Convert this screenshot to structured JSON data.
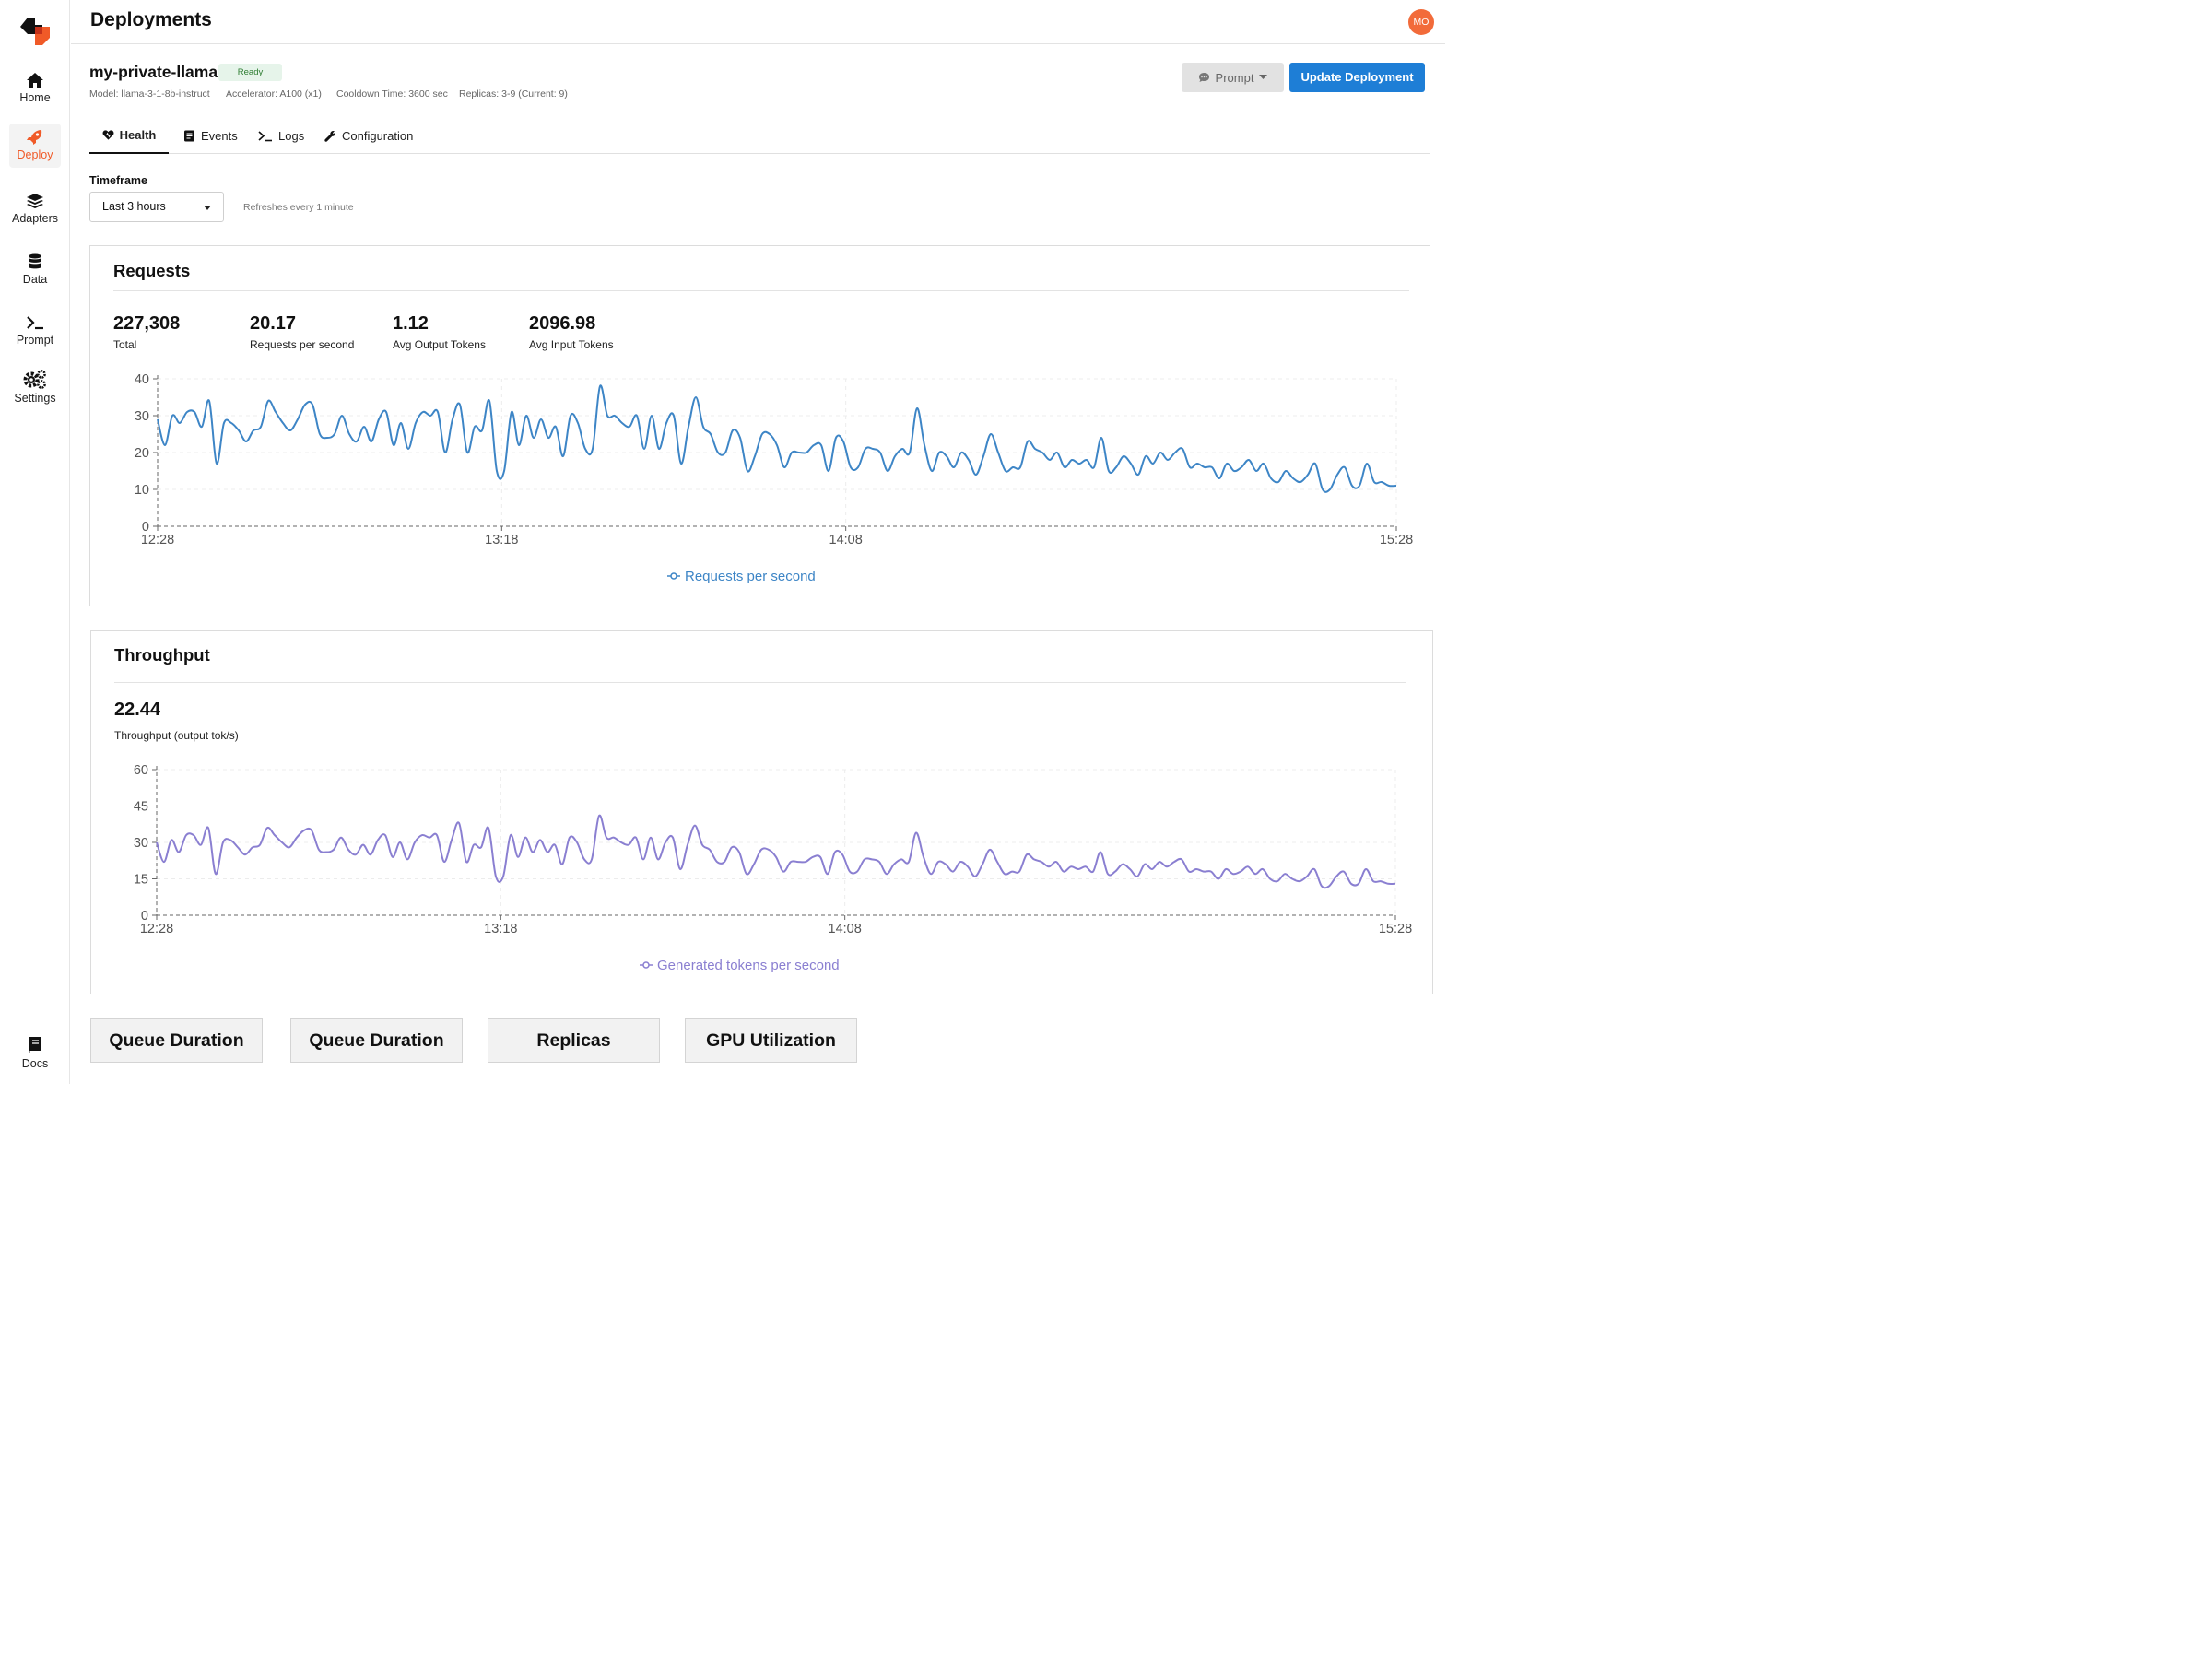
{
  "sidebar": {
    "items": [
      {
        "label": "Home"
      },
      {
        "label": "Deploy"
      },
      {
        "label": "Adapters"
      },
      {
        "label": "Data"
      },
      {
        "label": "Prompt"
      },
      {
        "label": "Settings"
      }
    ],
    "docs_label": "Docs"
  },
  "header": {
    "title": "Deployments",
    "avatar_initials": "MO"
  },
  "deployment": {
    "name": "my-private-llama",
    "status": "Ready",
    "model": "Model: llama-3-1-8b-instruct",
    "accelerator": "Accelerator:  A100 (x1)",
    "cooldown": "Cooldown Time: 3600 sec",
    "replicas": "Replicas: 3-9 (Current: 9)",
    "prompt_button": "Prompt",
    "update_button": "Update Deployment"
  },
  "tabs": [
    {
      "label": "Health",
      "icon": "heart-icon",
      "active": true
    },
    {
      "label": "Events",
      "icon": "events-icon"
    },
    {
      "label": "Logs",
      "icon": "terminal-icon"
    },
    {
      "label": "Configuration",
      "icon": "wrench-icon"
    }
  ],
  "timeframe": {
    "label": "Timeframe",
    "selected": "Last 3 hours",
    "refresh_note": "Refreshes every 1 minute"
  },
  "requests": {
    "title": "Requests",
    "stats": [
      {
        "value": "227,308",
        "label": "Total"
      },
      {
        "value": "20.17",
        "label": "Requests per second"
      },
      {
        "value": "1.12",
        "label": "Avg Output Tokens"
      },
      {
        "value": "2096.98",
        "label": "Avg Input Tokens"
      }
    ]
  },
  "throughput": {
    "title": "Throughput",
    "stat_value": "22.44",
    "stat_label": "Throughput (output tok/s)"
  },
  "bottom_sections": [
    "Queue Duration",
    "Queue Duration",
    "Replicas",
    "GPU Utilization"
  ],
  "colors": {
    "accent_orange": "#f05a28",
    "primary_blue": "#1e7ed6",
    "requests_line": "#3d85c6",
    "throughput_line": "#8a7fd1"
  },
  "chart_data": [
    {
      "type": "line",
      "title": "",
      "x": [
        "12:28",
        "13:18",
        "14:08",
        "15:28"
      ],
      "x_range": [
        "12:28",
        "15:28"
      ],
      "ylim": [
        0,
        40
      ],
      "yticks": [
        0,
        10,
        20,
        30,
        40
      ],
      "grid": true,
      "legend_position": "bottom-center",
      "series": [
        {
          "name": "Requests per second",
          "values": [
            29,
            22,
            30,
            28,
            31,
            31,
            27,
            34,
            17,
            28,
            28,
            26,
            23,
            26,
            27,
            34,
            31,
            28,
            26,
            29,
            33,
            33,
            25,
            24,
            25,
            30,
            25,
            23,
            27,
            23,
            29,
            31,
            22,
            28,
            21,
            28,
            31,
            30,
            31,
            20,
            29,
            33,
            20,
            27,
            26,
            34,
            15,
            15,
            31,
            22,
            30,
            24,
            29,
            24,
            27,
            19,
            30,
            28,
            21,
            21,
            38,
            30,
            30,
            28,
            27,
            30,
            21,
            30,
            21,
            28,
            30,
            17,
            27,
            35,
            27,
            25,
            20,
            20,
            26,
            24,
            15,
            19,
            25,
            25,
            22,
            16,
            20,
            20,
            20,
            22,
            22,
            15,
            24,
            23,
            16,
            16,
            21,
            21,
            20,
            15,
            19,
            21,
            20,
            32,
            22,
            15,
            20,
            19,
            16,
            20,
            18,
            14,
            19,
            25,
            20,
            15,
            16,
            16,
            23,
            21,
            20,
            18,
            20,
            16,
            18,
            17,
            18,
            16,
            24,
            15,
            16,
            19,
            17,
            14,
            19,
            17,
            20,
            18,
            20,
            21,
            16,
            17,
            16,
            16,
            13,
            17,
            15,
            16,
            18,
            15,
            17,
            13,
            12,
            15,
            13,
            12,
            14,
            17,
            10,
            10,
            14,
            16,
            11,
            11,
            17,
            12,
            12,
            11,
            11
          ],
          "color": "#3d85c6"
        }
      ]
    },
    {
      "type": "line",
      "title": "",
      "x": [
        "12:28",
        "13:18",
        "14:08",
        "15:28"
      ],
      "x_range": [
        "12:28",
        "15:28"
      ],
      "ylim": [
        0,
        60
      ],
      "yticks": [
        0,
        15,
        30,
        45,
        60
      ],
      "grid": true,
      "legend_position": "bottom-center",
      "series": [
        {
          "name": "Generated tokens per second",
          "values": [
            30,
            22,
            31,
            26,
            33,
            33,
            29,
            36,
            17,
            30,
            31,
            28,
            25,
            28,
            29,
            36,
            33,
            30,
            28,
            32,
            35,
            35,
            27,
            26,
            27,
            32,
            27,
            25,
            29,
            25,
            31,
            33,
            24,
            30,
            23,
            30,
            33,
            32,
            33,
            22,
            31,
            38,
            22,
            29,
            28,
            36,
            16,
            16,
            33,
            24,
            32,
            26,
            31,
            26,
            29,
            21,
            32,
            30,
            23,
            23,
            41,
            32,
            32,
            30,
            29,
            32,
            23,
            32,
            23,
            30,
            32,
            19,
            29,
            37,
            29,
            27,
            22,
            22,
            28,
            26,
            17,
            21,
            27,
            27,
            24,
            18,
            22,
            22,
            22,
            24,
            24,
            17,
            26,
            25,
            18,
            18,
            23,
            23,
            22,
            17,
            21,
            23,
            22,
            34,
            24,
            17,
            22,
            21,
            18,
            22,
            20,
            16,
            21,
            27,
            22,
            17,
            18,
            18,
            25,
            23,
            22,
            20,
            22,
            18,
            20,
            19,
            20,
            18,
            26,
            17,
            18,
            21,
            19,
            16,
            21,
            19,
            22,
            20,
            22,
            23,
            18,
            19,
            18,
            18,
            15,
            19,
            17,
            18,
            20,
            17,
            19,
            15,
            14,
            17,
            15,
            14,
            16,
            19,
            12,
            12,
            16,
            18,
            13,
            13,
            19,
            14,
            14,
            13,
            13
          ],
          "color": "#8a7fd1"
        }
      ]
    }
  ]
}
